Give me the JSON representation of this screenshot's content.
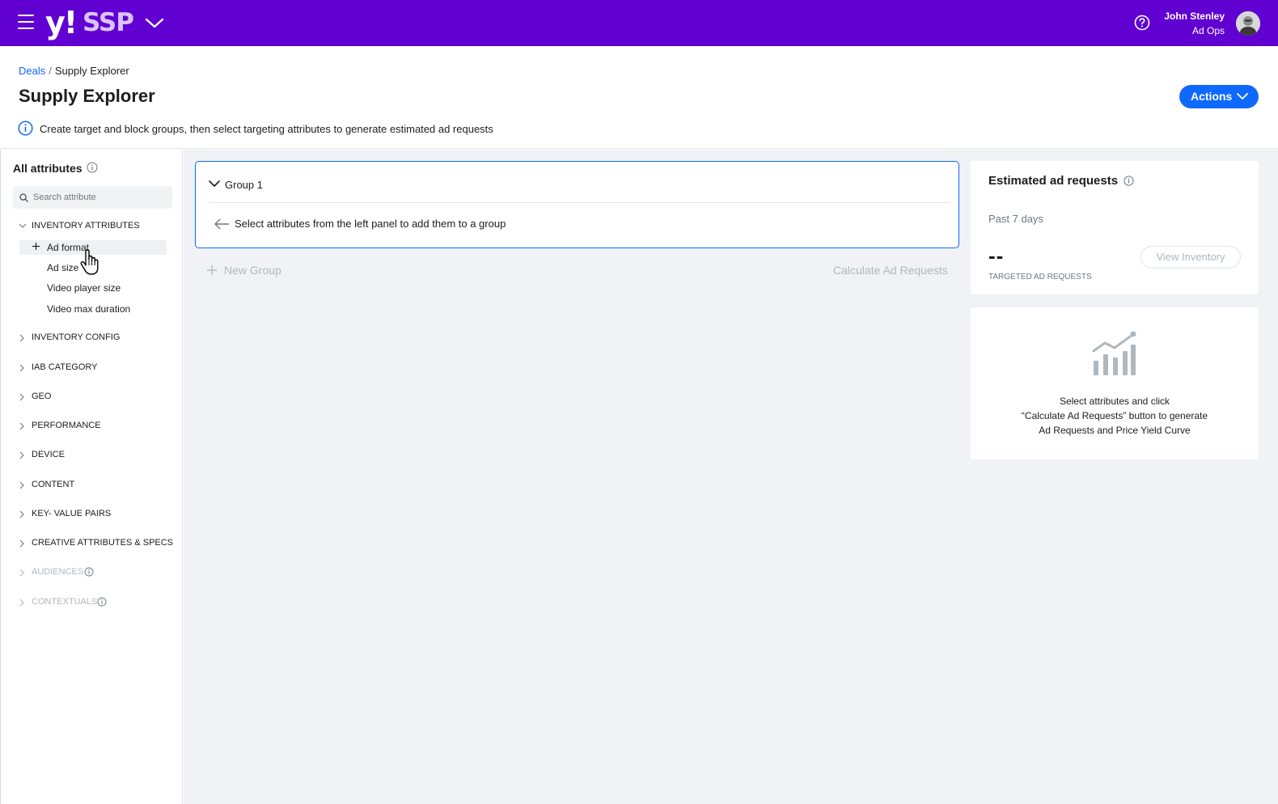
{
  "topbar": {
    "logo_y": "y!",
    "logo_product": "SSP",
    "user_name": "John Stenley",
    "user_role": "Ad Ops",
    "brand_color": "#6001d2"
  },
  "header": {
    "breadcrumb": {
      "parent": "Deals",
      "separator": "/",
      "current": "Supply Explorer"
    },
    "title": "Supply Explorer",
    "actions_label": "Actions",
    "info_text": "Create target and block groups, then select targeting attributes to generate estimated ad requests"
  },
  "sidebar": {
    "title": "All attributes",
    "search_placeholder": "Search attribute",
    "inventory_attributes": {
      "label": "INVENTORY ATTRIBUTES",
      "expanded": true,
      "items": [
        "Ad format",
        "Ad size",
        "Video player size",
        "Video max duration"
      ]
    },
    "categories": [
      {
        "label": "INVENTORY CONFIG",
        "disabled": false
      },
      {
        "label": "IAB CATEGORY",
        "disabled": false
      },
      {
        "label": "GEO",
        "disabled": false
      },
      {
        "label": "PERFORMANCE",
        "disabled": false
      },
      {
        "label": "DEVICE",
        "disabled": false
      },
      {
        "label": "CONTENT",
        "disabled": false
      },
      {
        "label": "KEY- VALUE PAIRS",
        "disabled": false
      },
      {
        "label": "CREATIVE ATTRIBUTES & SPECS",
        "disabled": false
      },
      {
        "label": "AUDIENCES",
        "disabled": true
      },
      {
        "label": "CONTEXTUALS",
        "disabled": true
      }
    ]
  },
  "main": {
    "group": {
      "name": "Group 1",
      "hint": "Select attributes from the left panel to add them to a group"
    },
    "new_group_label": "New Group",
    "calculate_label": "Calculate Ad Requests",
    "estimate": {
      "title": "Estimated ad requests",
      "period": "Past 7 days",
      "value": "--",
      "value_label": "TARGETED AD REQUESTS",
      "view_inventory_label": "View Inventory"
    },
    "empty_state": {
      "line1": "Select attributes and click",
      "line2": "“Calculate Ad Requests” button to generate",
      "line3": "Ad Requests and Price Yield Curve"
    }
  },
  "colors": {
    "accent": "#0f69ff",
    "background": "#f0f2f5",
    "disabled_text": "#b0b7bf"
  }
}
